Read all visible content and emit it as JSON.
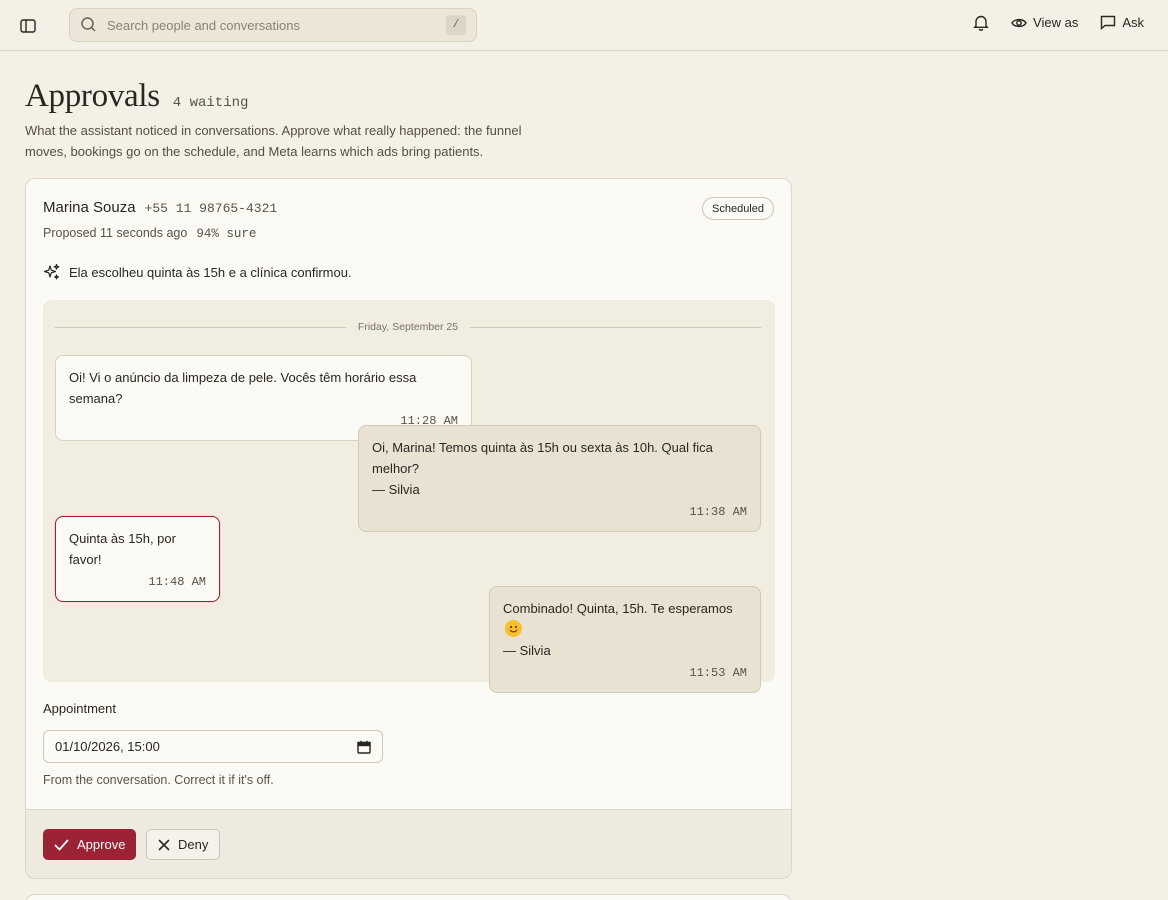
{
  "topbar": {
    "search_placeholder": "Search people and conversations",
    "search_shortcut": "/",
    "view_as_label": "View as",
    "ask_label": "Ask"
  },
  "page": {
    "title": "Approvals",
    "waiting": "4 waiting",
    "subtitle": "What the assistant noticed in conversations. Approve what really happened: the funnel moves, bookings go on the schedule, and Meta learns which ads bring patients."
  },
  "card": {
    "contact_name": "Marina Souza",
    "contact_phone": "+55 11 98765-4321",
    "status": "Scheduled",
    "proposed": "Proposed 11 seconds ago",
    "confidence": "94% sure",
    "summary": "Ela escolheu quinta às 15h e a clínica confirmou.",
    "conversation": {
      "date": "Friday, September 25",
      "messages": [
        {
          "direction": "in",
          "text": "Oi! Vi o anúncio da limpeza de pele. Vocês têm horário essa semana?",
          "time": "11:28 AM"
        },
        {
          "direction": "out",
          "text": "Oi, Marina! Temos quinta às 15h ou sexta às 10h. Qual fica melhor?",
          "signature": "— Silvia",
          "time": "11:38 AM"
        },
        {
          "direction": "in",
          "text": "Quinta às 15h, por favor!",
          "time": "11:48 AM",
          "highlighted": true
        },
        {
          "direction": "out",
          "text": "Combinado! Quinta, 15h. Te esperamos",
          "signature": "— Silvia",
          "time": "11:53 AM",
          "emoji": "smiling-face-icon"
        }
      ]
    },
    "appointment": {
      "label": "Appointment",
      "value": "01/10/2026, 15:00",
      "hint": "From the conversation. Correct it if it's off."
    },
    "actions": {
      "approve_label": "Approve",
      "deny_label": "Deny"
    }
  },
  "colors": {
    "background": "#f4f0e6",
    "card": "#fcfaf4",
    "accent": "#9b2335",
    "bubble_out": "#e8e2d3"
  }
}
